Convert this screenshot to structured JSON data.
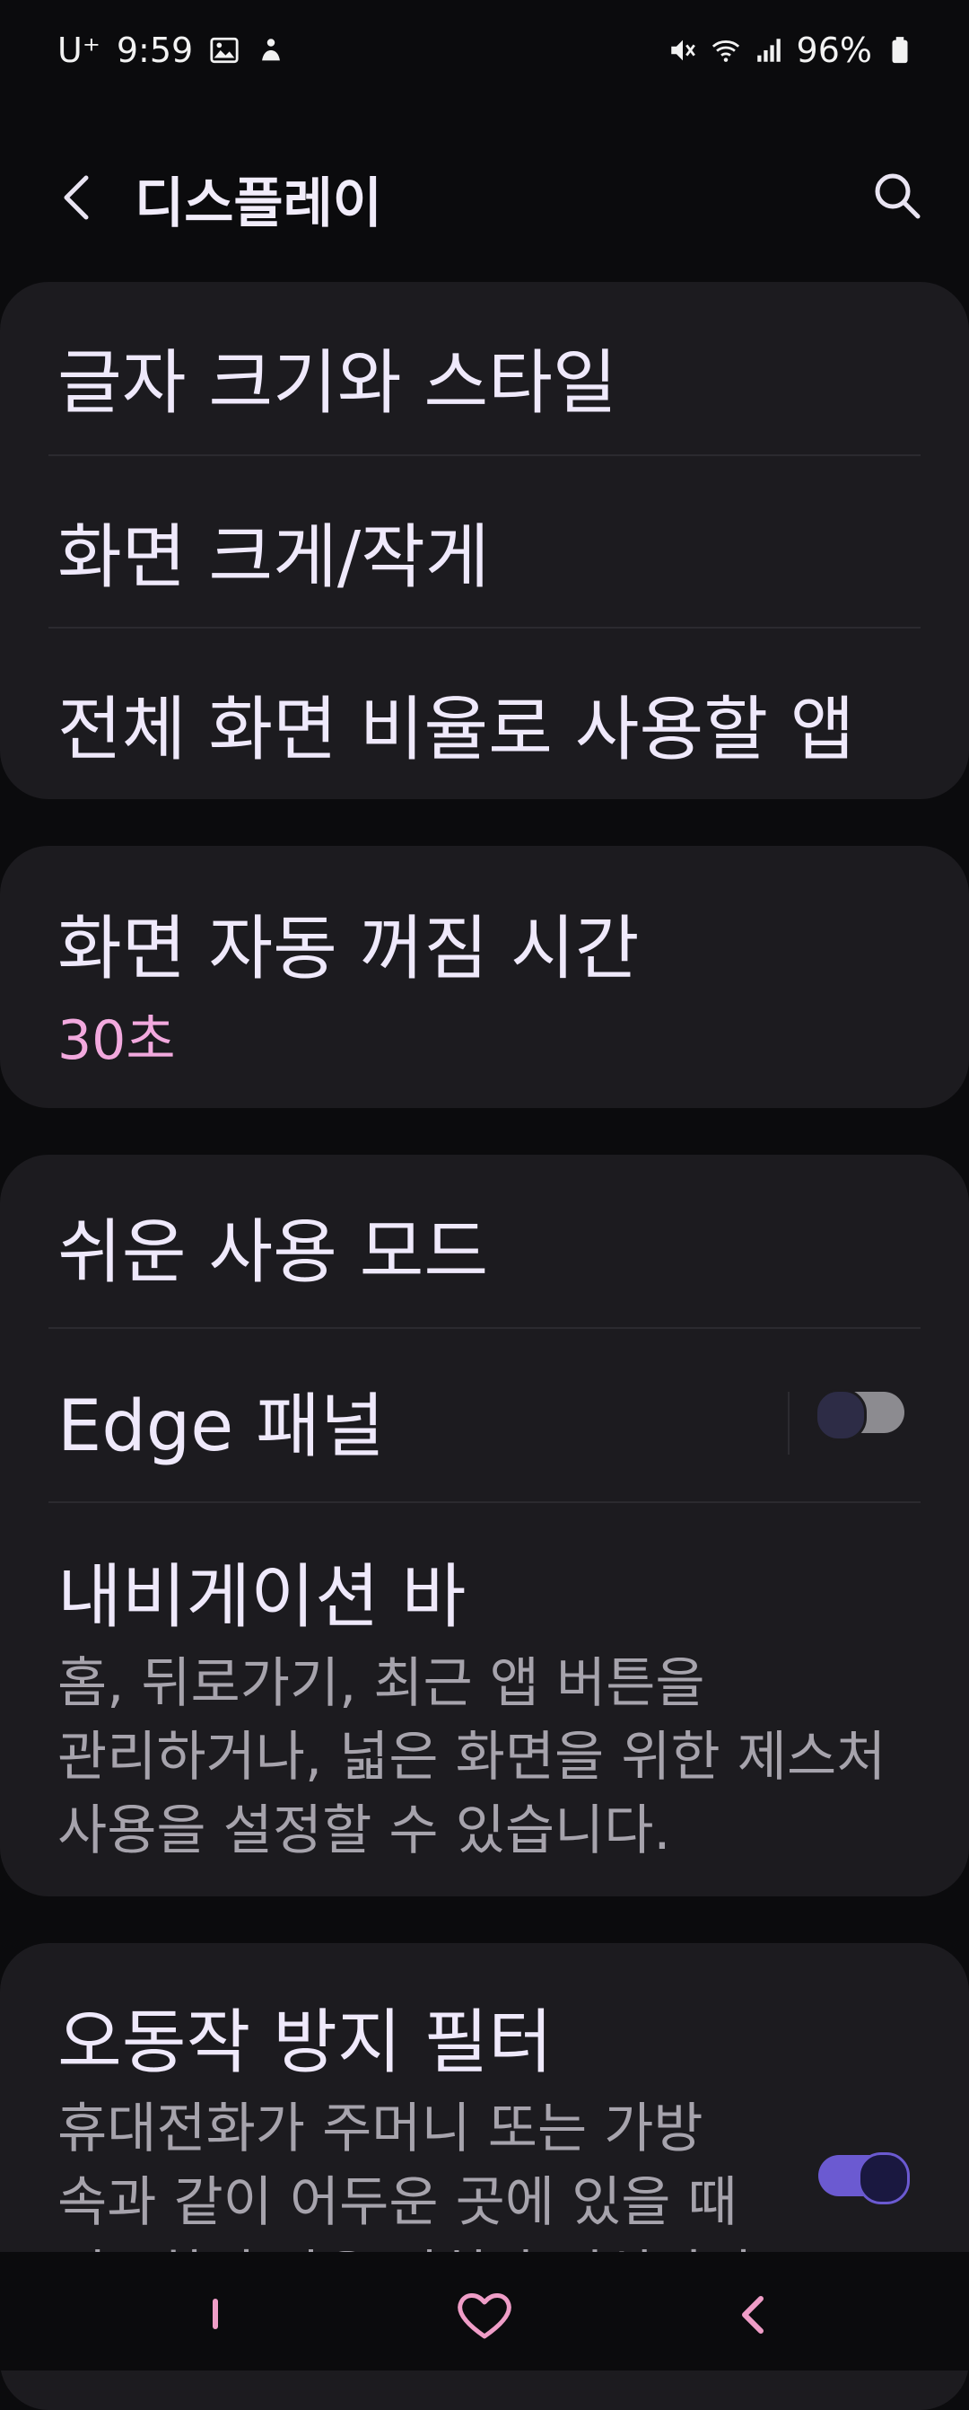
{
  "status": {
    "carrier": "U⁺",
    "time": "9:59",
    "battery": "96%"
  },
  "header": {
    "title": "디스플레이"
  },
  "cards": {
    "text": {
      "font_style": "글자 크기와 스타일",
      "screen_zoom": "화면 크게/작게",
      "fullscreen_apps": "전체 화면 비율로 사용할 앱"
    },
    "timeout": {
      "title": "화면 자동 꺼짐 시간",
      "value": "30초"
    },
    "misc": {
      "easy_mode": "쉬운 사용 모드",
      "edge_panels": "Edge 패널",
      "edge_panels_on": false,
      "navigation_bar": "내비게이션 바",
      "navigation_bar_desc_line1": "홈, 뒤로가기, 최근 앱 버튼을",
      "navigation_bar_desc_line2": "관리하거나, 넓은 화면을 위한 제스처",
      "navigation_bar_desc_line3": "사용을 설정할 수 있습니다."
    },
    "protect": {
      "title": "오동작 방지 필터",
      "desc_line1": "휴대전화가 주머니 또는 가방",
      "desc_line2": "속과 같이 어두운 곳에 있을 때",
      "desc_line3": "의도하지 않은 터치가 인식되지",
      "enabled": true
    }
  },
  "colors": {
    "accent": "#6b5ad1",
    "value_pink": "#f2a9de",
    "card_bg": "#1c1b1f"
  }
}
